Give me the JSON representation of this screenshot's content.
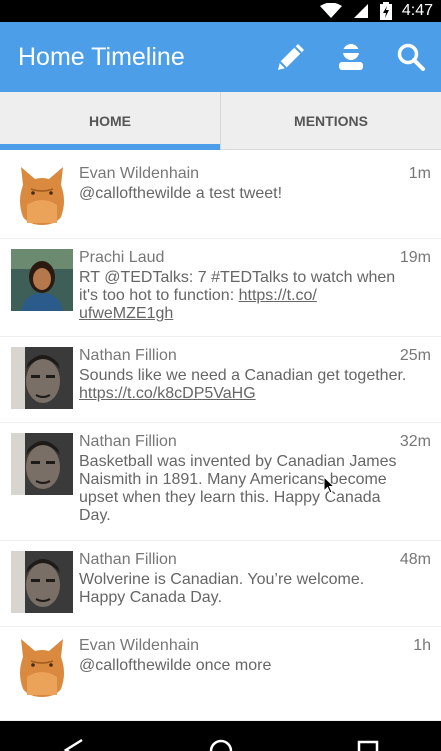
{
  "status_bar": {
    "time": "4:47",
    "icons": [
      "wifi-icon",
      "signal-icon",
      "battery-icon"
    ]
  },
  "app_bar": {
    "title": "Home Timeline",
    "actions": [
      "compose-icon",
      "profile-icon",
      "search-icon"
    ],
    "color": "#4c9ee8"
  },
  "tabs": [
    {
      "label": "HOME",
      "active": true
    },
    {
      "label": "MENTIONS",
      "active": false
    }
  ],
  "tweets": [
    {
      "name": "Evan Wildenhain",
      "age": "1m",
      "text": "@callofthewilde a test tweet!",
      "avatar": "dog-avatar"
    },
    {
      "name": "Prachi Laud",
      "age": "19m",
      "text_lines": [
        "RT @TEDTalks: 7 #TEDTalks to watch when",
        "it's too hot to function: "
      ],
      "link_part1": "https://t.co/",
      "link_part2": "ufweMZE1gh",
      "avatar": "person-avatar"
    },
    {
      "name": "Nathan Fillion",
      "age": "25m",
      "text": "Sounds like we need a Canadian get together.",
      "link": "https://t.co/k8cDP5VaHG",
      "avatar": "face-avatar"
    },
    {
      "name": "Nathan Fillion",
      "age": "32m",
      "text_lines": [
        "Basketball was invented by Canadian James",
        "Naismith in 1891. Many Americans become",
        "upset when they learn this. Happy Canada",
        "Day."
      ],
      "avatar": "face-avatar"
    },
    {
      "name": "Nathan Fillion",
      "age": "48m",
      "text_lines": [
        "Wolverine is Canadian. You’re welcome.",
        "Happy Canada Day."
      ],
      "avatar": "face-avatar"
    },
    {
      "name": "Evan Wildenhain",
      "age": "1h",
      "text": "@callofthewilde once more",
      "avatar": "dog-avatar"
    }
  ],
  "nav_bar": {
    "buttons": [
      "back-icon",
      "home-icon",
      "recents-icon"
    ]
  }
}
